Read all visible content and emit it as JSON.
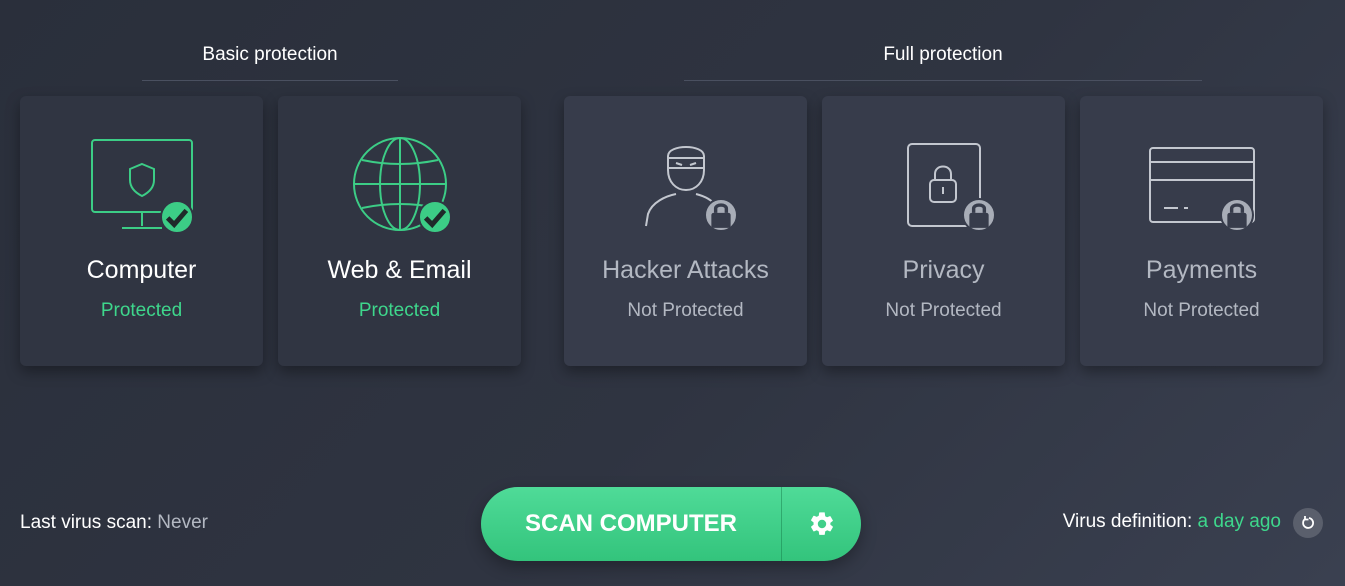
{
  "sections": {
    "basic_title": "Basic protection",
    "full_title": "Full protection"
  },
  "cards": [
    {
      "name": "Computer",
      "status": "Protected",
      "icon": "monitor-shield-icon",
      "state": "protected"
    },
    {
      "name": "Web & Email",
      "status": "Protected",
      "icon": "globe-icon",
      "state": "protected"
    },
    {
      "name": "Hacker Attacks",
      "status": "Not Protected",
      "icon": "hacker-icon",
      "state": "locked"
    },
    {
      "name": "Privacy",
      "status": "Not Protected",
      "icon": "phone-lock-icon",
      "state": "locked"
    },
    {
      "name": "Payments",
      "status": "Not Protected",
      "icon": "credit-card-icon",
      "state": "locked"
    }
  ],
  "footer": {
    "last_scan_label": "Last virus scan:",
    "last_scan_value": "Never",
    "virus_def_label": "Virus definition:",
    "virus_def_value": "a day ago"
  },
  "scan_button": {
    "label": "SCAN COMPUTER"
  },
  "colors": {
    "accent_green": "#3ed78c",
    "muted_text": "#b3b8c2",
    "background": "#2f3441"
  }
}
